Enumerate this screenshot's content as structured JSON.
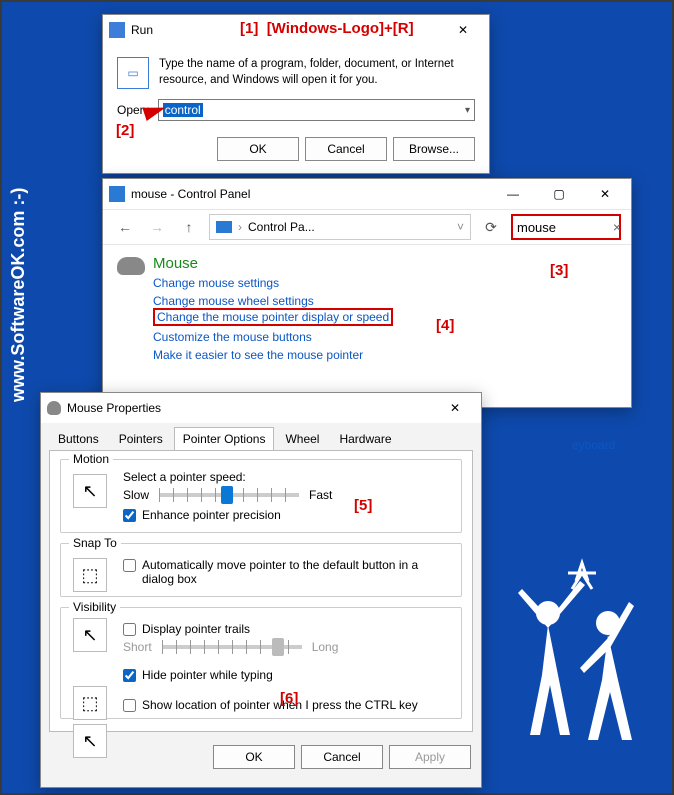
{
  "brand": {
    "vertical": "www.SoftwareOK.com :-)",
    "watermark": "SoftwareOK.com"
  },
  "annotations": {
    "a1": "[1]",
    "a1hint": "[Windows-Logo]+[R]",
    "a2": "[2]",
    "a3": "[3]",
    "a4": "[4]",
    "a5": "[5]",
    "a6": "[6]"
  },
  "run": {
    "title": "Run",
    "desc": "Type the name of a program, folder, document, or Internet resource, and Windows will open it for you.",
    "open_label": "Open:",
    "value": "control",
    "ok": "OK",
    "cancel": "Cancel",
    "browse": "Browse..."
  },
  "cp": {
    "title": "mouse - Control Panel",
    "breadcrumb1": "Control Pa...",
    "search_value": "mouse",
    "heading": "Mouse",
    "links": [
      "Change mouse settings",
      "Change mouse wheel settings",
      "Change the mouse pointer display or speed",
      "Customize the mouse buttons",
      "Make it easier to see the mouse pointer"
    ],
    "keyboard_hint": "eyboard",
    "chevron": "›"
  },
  "mp": {
    "title": "Mouse Properties",
    "tabs": [
      "Buttons",
      "Pointers",
      "Pointer Options",
      "Wheel",
      "Hardware"
    ],
    "motion": {
      "title": "Motion",
      "select": "Select a pointer speed:",
      "slow": "Slow",
      "fast": "Fast",
      "enhance": "Enhance pointer precision"
    },
    "snap": {
      "title": "Snap To",
      "auto": "Automatically move pointer to the default button in a dialog box"
    },
    "vis": {
      "title": "Visibility",
      "trails": "Display pointer trails",
      "short": "Short",
      "long": "Long",
      "hide": "Hide pointer while typing",
      "ctrl": "Show location of pointer when I press the CTRL key"
    },
    "ok": "OK",
    "cancel": "Cancel",
    "apply": "Apply"
  }
}
